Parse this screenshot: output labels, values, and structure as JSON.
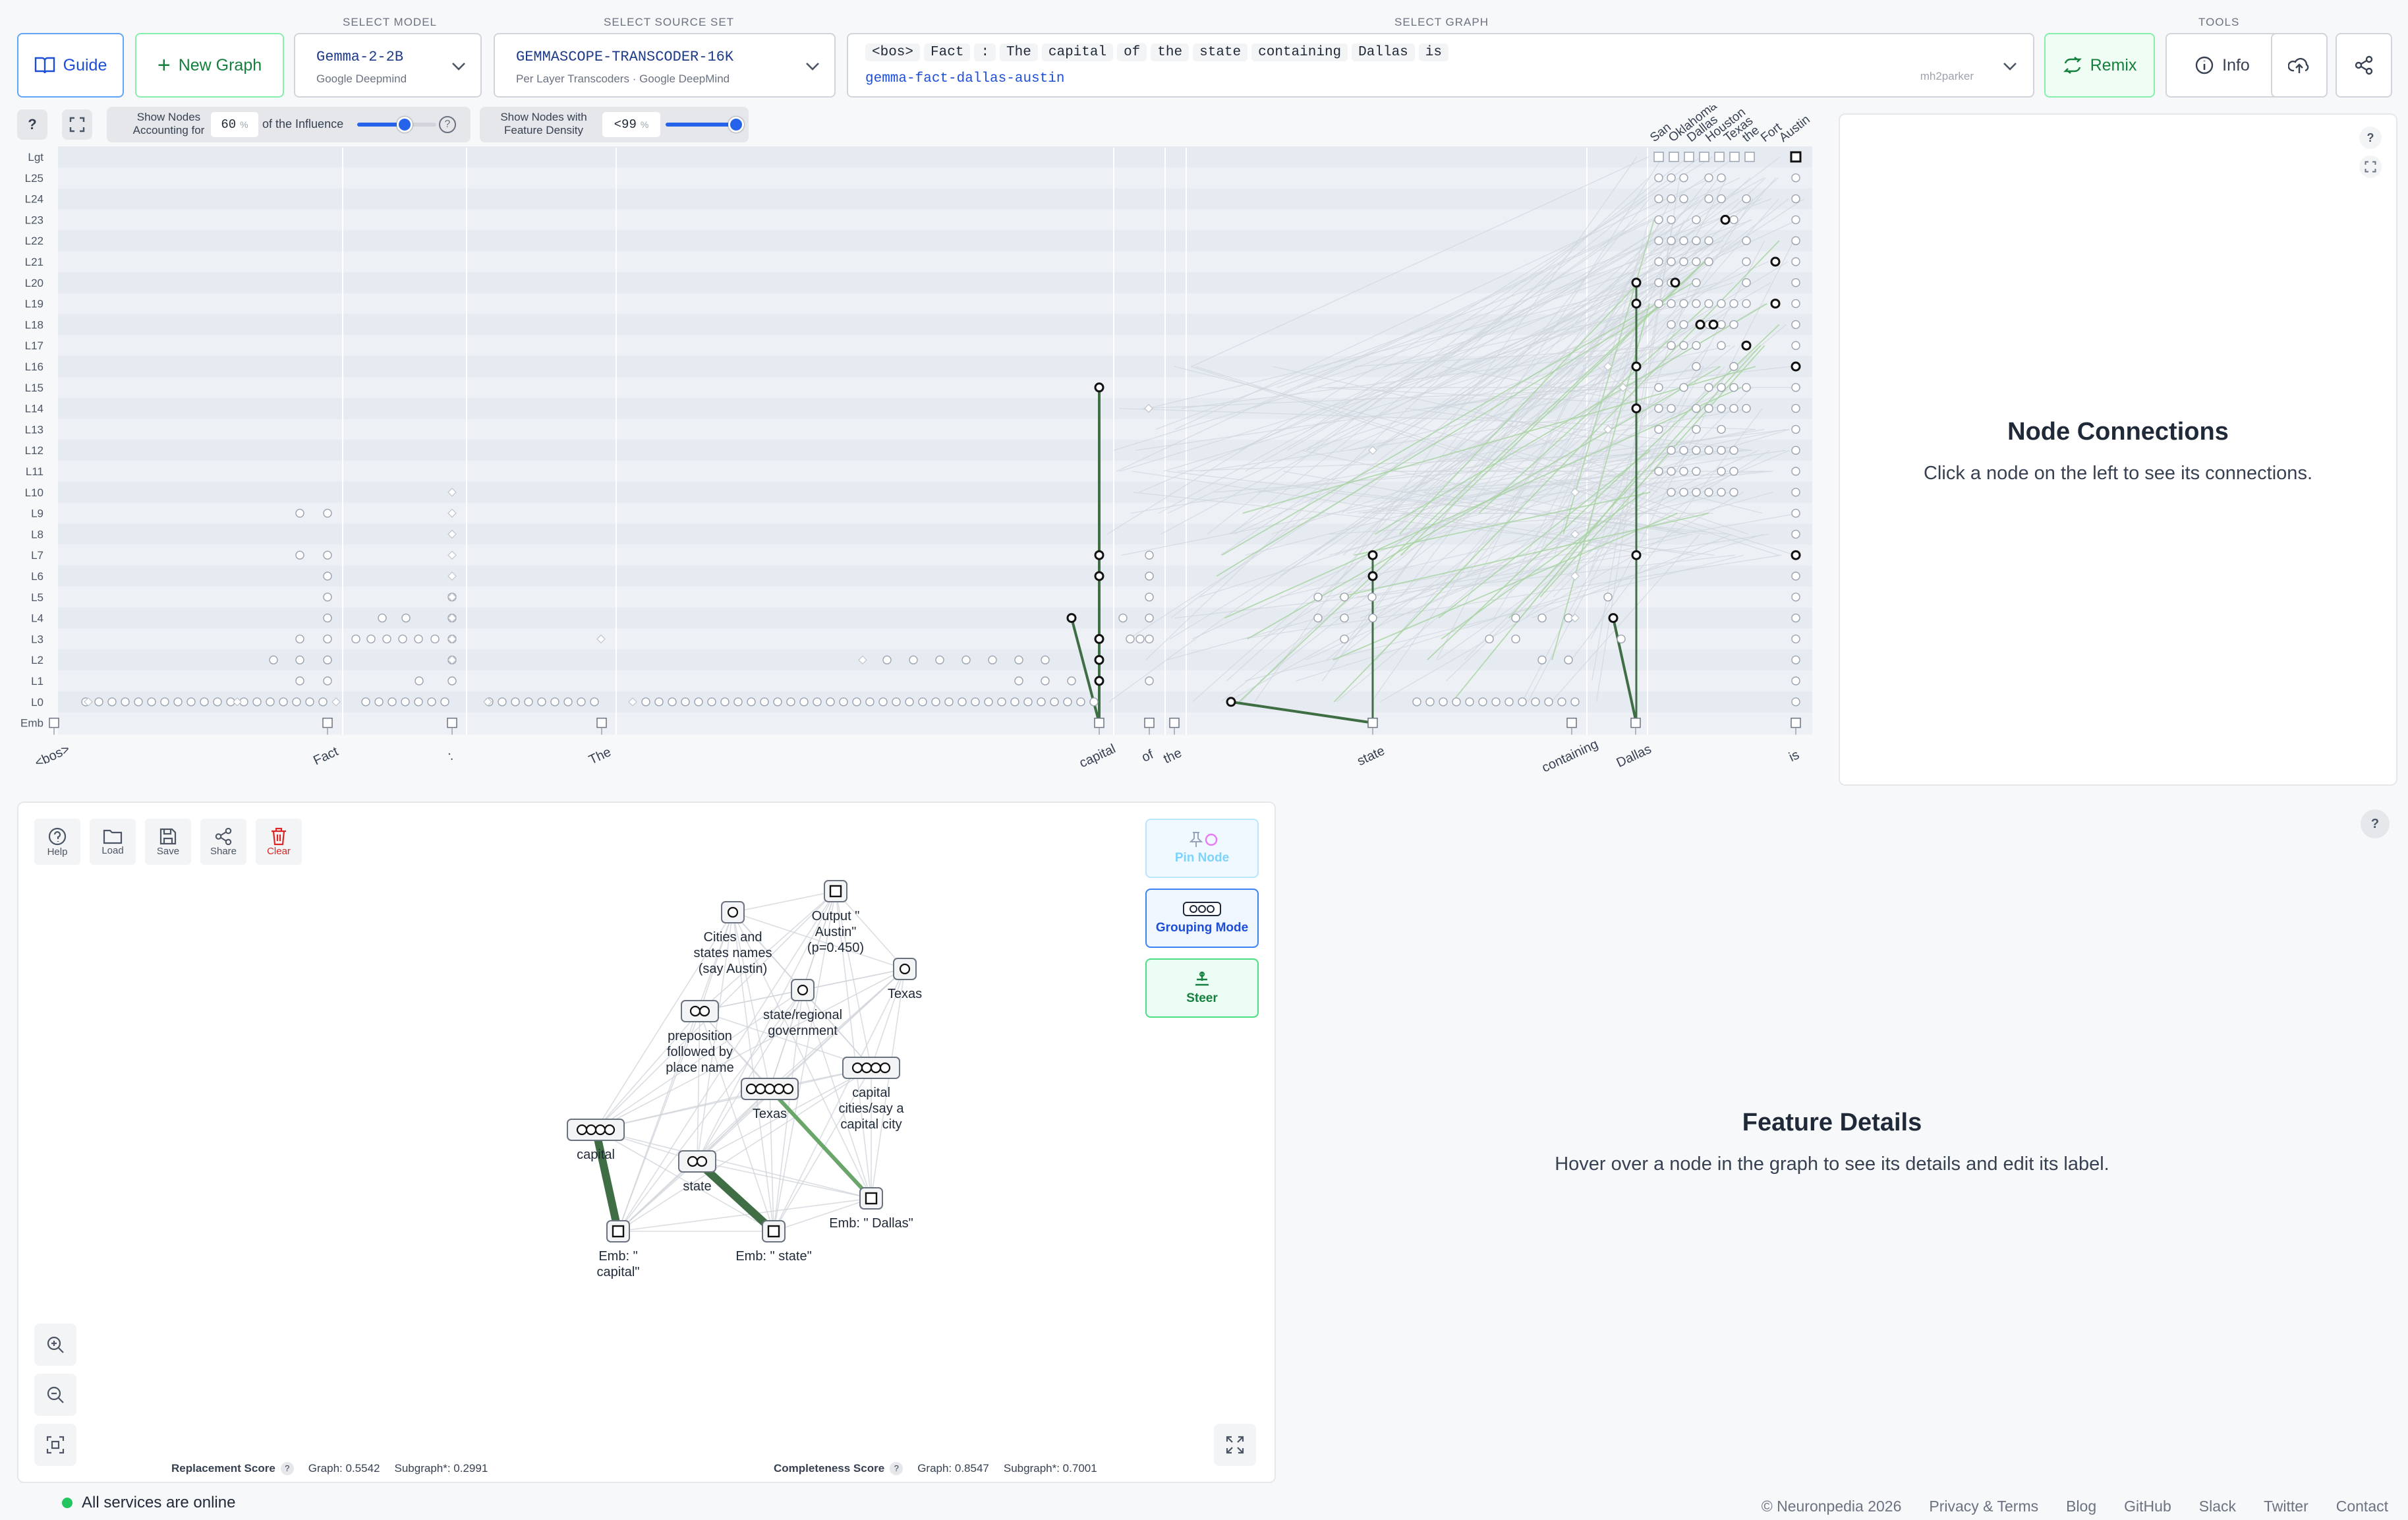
{
  "header": {
    "guide_label": "Guide",
    "new_graph_label": "New Graph",
    "select_model_label": "SELECT MODEL",
    "model_name": "Gemma-2-2B",
    "model_org": "Google Deepmind",
    "select_source_label": "SELECT SOURCE SET",
    "source_name": "GEMMASCOPE-TRANSCODER-16K",
    "source_desc": "Per Layer Transcoders · Google DeepMind",
    "select_graph_label": "SELECT GRAPH",
    "graph_tokens": [
      "<bos>",
      "Fact",
      ":",
      "The",
      "capital",
      "of",
      "the",
      "state",
      "containing",
      "Dallas",
      "is"
    ],
    "graph_slug": "gemma-fact-dallas-austin",
    "graph_author": "mh2parker",
    "remix_label": "Remix",
    "tools_label": "TOOLS",
    "info_label": "Info"
  },
  "controls": {
    "help_symbol": "?",
    "show_nodes_label_1": "Show Nodes",
    "show_nodes_label_2": "Accounting for",
    "influence_value": "60",
    "percent": "%",
    "influence_suffix": "of the Influence",
    "influence_level": 0.6,
    "density_label_1": "Show Nodes with",
    "density_label_2": "Feature Density",
    "density_value": "<99",
    "density_level": 0.99
  },
  "graph": {
    "layers": [
      "Lgt",
      "L25",
      "L24",
      "L23",
      "L22",
      "L21",
      "L20",
      "L19",
      "L18",
      "L17",
      "L16",
      "L15",
      "L14",
      "L13",
      "L12",
      "L11",
      "L10",
      "L9",
      "L8",
      "L7",
      "L6",
      "L5",
      "L4",
      "L3",
      "L2",
      "L1",
      "L0",
      "Emb"
    ],
    "tokens": [
      "<bos>",
      "Fact",
      ":",
      "The",
      "capital",
      "of",
      "the",
      "state",
      "containing",
      "Dallas",
      "is"
    ],
    "logit_labels": [
      "San",
      "Oklahoma",
      "Dallas",
      "Houston",
      "Texas",
      "the",
      "Fort",
      "Austin"
    ]
  },
  "connections": {
    "title": "Node Connections",
    "subtitle": "Click a node on the left to see its connections.",
    "help": "?"
  },
  "subgraph": {
    "tools": [
      "Help",
      "Load",
      "Save",
      "Share",
      "Clear"
    ],
    "pin_label": "Pin Node",
    "grouping_label": "Grouping Mode",
    "steer_label": "Steer",
    "nodes": {
      "output": "Output \" Austin\" (p=0.450)",
      "cities": "Cities and states names (say Austin)",
      "texas_top": "Texas",
      "state_gov": "state/regional government",
      "preposition": "preposition followed by place name",
      "capital_cities": "capital cities/say a capital city",
      "texas_mid": "Texas",
      "capital": "capital",
      "state": "state",
      "emb_capital": "Emb: \" capital\"",
      "emb_state": "Emb: \" state\"",
      "emb_dallas": "Emb: \" Dallas\""
    },
    "replacement_label": "Replacement Score",
    "replacement_graph": "Graph: 0.5542",
    "replacement_sub": "Subgraph*: 0.2991",
    "completeness_label": "Completeness Score",
    "completeness_graph": "Graph: 0.8547",
    "completeness_sub": "Subgraph*: 0.7001"
  },
  "details": {
    "title": "Feature Details",
    "subtitle": "Hover over a node in the graph to see its details and edit its label.",
    "help": "?"
  },
  "footer": {
    "status": "All services are online",
    "copyright": "© Neuronpedia 2026",
    "links": [
      "Privacy & Terms",
      "Blog",
      "GitHub",
      "Slack",
      "Twitter",
      "Contact"
    ]
  },
  "colors": {
    "accent_blue": "#2563eb",
    "accent_green": "#15803d",
    "edge_green": "#3f6e45",
    "danger": "#dc2626",
    "online": "#22c55e"
  }
}
